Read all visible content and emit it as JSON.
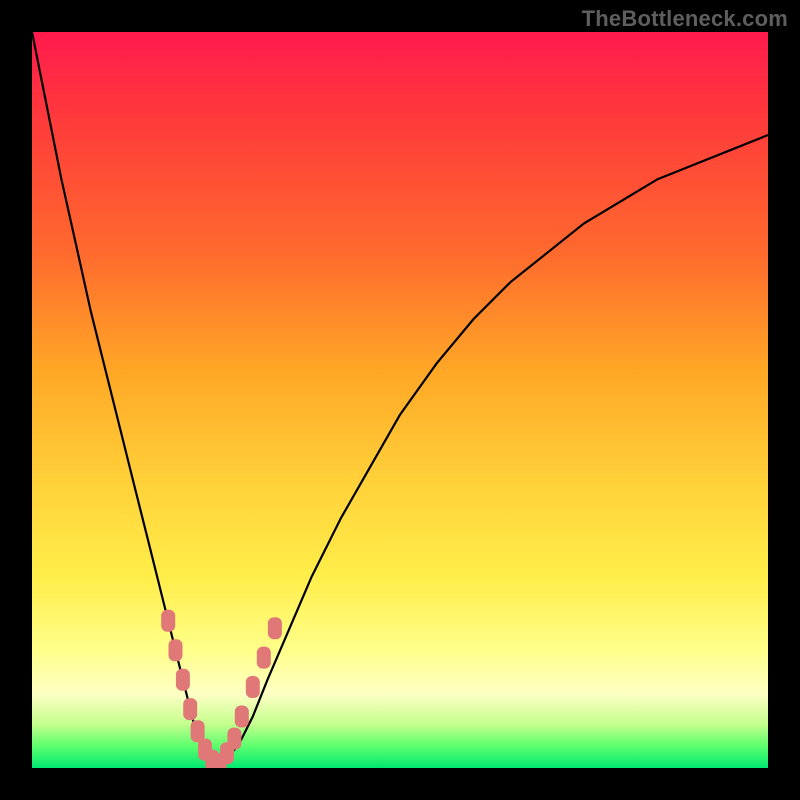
{
  "watermark": "TheBottleneck.com",
  "colors": {
    "frame": "#000000",
    "gradient_top": "#ff1a4d",
    "gradient_bottom": "#00e870",
    "curve": "#000000",
    "marker": "#e07878"
  },
  "chart_data": {
    "type": "line",
    "title": "",
    "xlabel": "",
    "ylabel": "",
    "xlim": [
      0,
      100
    ],
    "ylim": [
      0,
      100
    ],
    "series": [
      {
        "name": "bottleneck-curve",
        "x": [
          0,
          2,
          4,
          6,
          8,
          10,
          12,
          14,
          16,
          18,
          20,
          21,
          22,
          23,
          24,
          25,
          26,
          28,
          30,
          32,
          35,
          38,
          42,
          46,
          50,
          55,
          60,
          65,
          70,
          75,
          80,
          85,
          90,
          95,
          100
        ],
        "y": [
          100,
          90,
          80,
          71,
          62,
          54,
          46,
          38,
          30,
          22,
          14,
          10,
          6,
          3,
          1,
          0,
          1,
          3,
          7,
          12,
          19,
          26,
          34,
          41,
          48,
          55,
          61,
          66,
          70,
          74,
          77,
          80,
          82,
          84,
          86
        ]
      }
    ],
    "markers": {
      "name": "highlighted-points",
      "points": [
        {
          "x": 18.5,
          "y": 20
        },
        {
          "x": 19.5,
          "y": 16
        },
        {
          "x": 20.5,
          "y": 12
        },
        {
          "x": 21.5,
          "y": 8
        },
        {
          "x": 22.5,
          "y": 5
        },
        {
          "x": 23.5,
          "y": 2.5
        },
        {
          "x": 24.5,
          "y": 1
        },
        {
          "x": 25.0,
          "y": 0.3
        },
        {
          "x": 25.5,
          "y": 0.5
        },
        {
          "x": 26.5,
          "y": 2
        },
        {
          "x": 27.5,
          "y": 4
        },
        {
          "x": 28.5,
          "y": 7
        },
        {
          "x": 30.0,
          "y": 11
        },
        {
          "x": 31.5,
          "y": 15
        },
        {
          "x": 33.0,
          "y": 19
        }
      ]
    }
  }
}
